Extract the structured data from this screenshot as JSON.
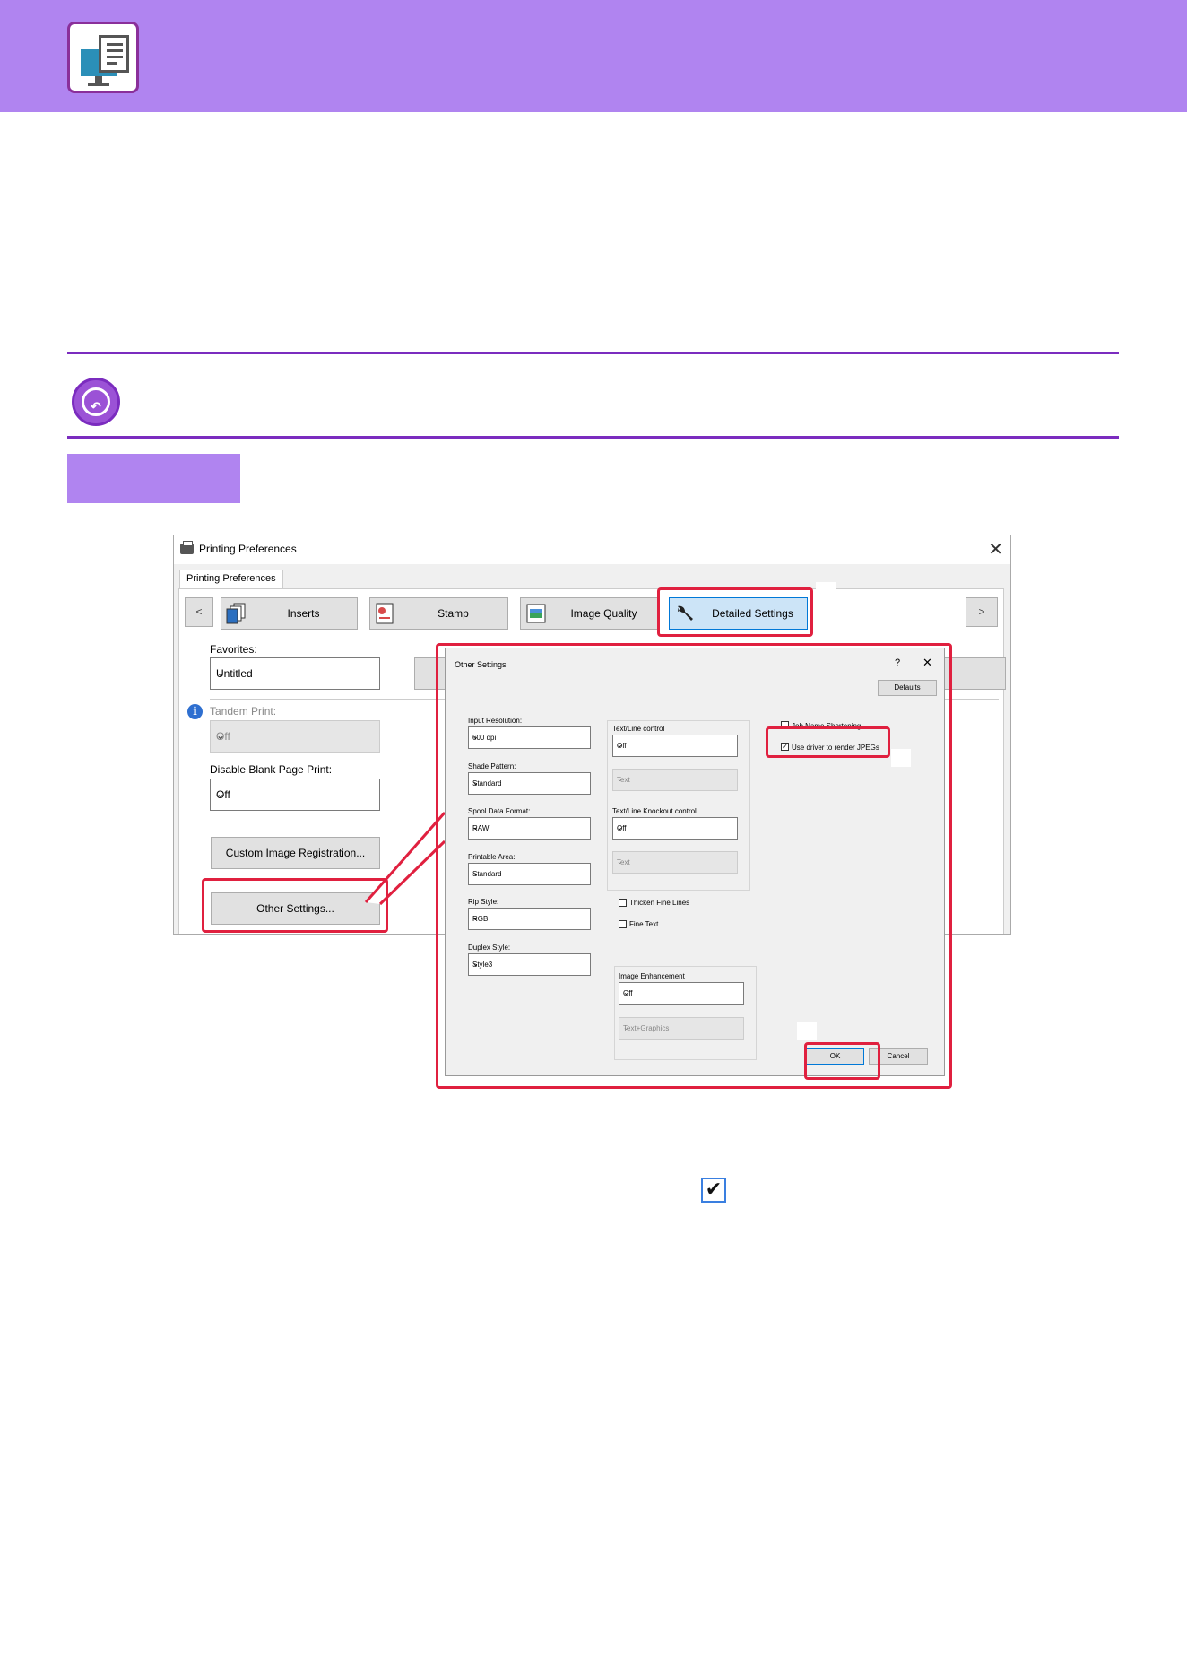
{
  "window": {
    "title": "Printing Preferences",
    "tab": "Printing Preferences",
    "nav_prev": "<",
    "nav_next": ">",
    "categories": [
      "Inserts",
      "Stamp",
      "Image Quality",
      "Detailed Settings"
    ],
    "favorites_label": "Favorites:",
    "favorites_value": "Untitled",
    "tandem_label": "Tandem Print:",
    "tandem_value": "Off",
    "blank_label": "Disable Blank Page Print:",
    "blank_value": "Off",
    "custom_image_button": "Custom Image Registration...",
    "other_settings_button": "Other Settings..."
  },
  "dialog": {
    "title": "Other Settings",
    "help": "?",
    "defaults_button": "Defaults",
    "input_resolution_label": "Input Resolution:",
    "input_resolution_value": "600 dpi",
    "shade_pattern_label": "Shade Pattern:",
    "shade_pattern_value": "Standard",
    "spool_label": "Spool Data Format:",
    "spool_value": "RAW",
    "printable_label": "Printable Area:",
    "printable_value": "Standard",
    "rip_label": "Rip Style:",
    "rip_value": "RGB",
    "duplex_label": "Duplex Style:",
    "duplex_value": "Style3",
    "text_line_label": "Text/Line control",
    "text_line_value": "Off",
    "text_line_sub_value": "Text",
    "knockout_label": "Text/Line Knockout control",
    "knockout_value": "Off",
    "knockout_sub_value": "Text",
    "thicken_label": "Thicken Fine Lines",
    "fine_text_label": "Fine Text",
    "enhance_label": "Image Enhancement",
    "enhance_value": "Off",
    "enhance_sub_value": "Text+Graphics",
    "job_name_label": "Job Name Shortening",
    "jpeg_label": "Use driver to render JPEGs",
    "ok_button": "OK",
    "cancel_button": "Cancel"
  },
  "highlight_color": "#e0203f",
  "accent_color": "#b084f0"
}
